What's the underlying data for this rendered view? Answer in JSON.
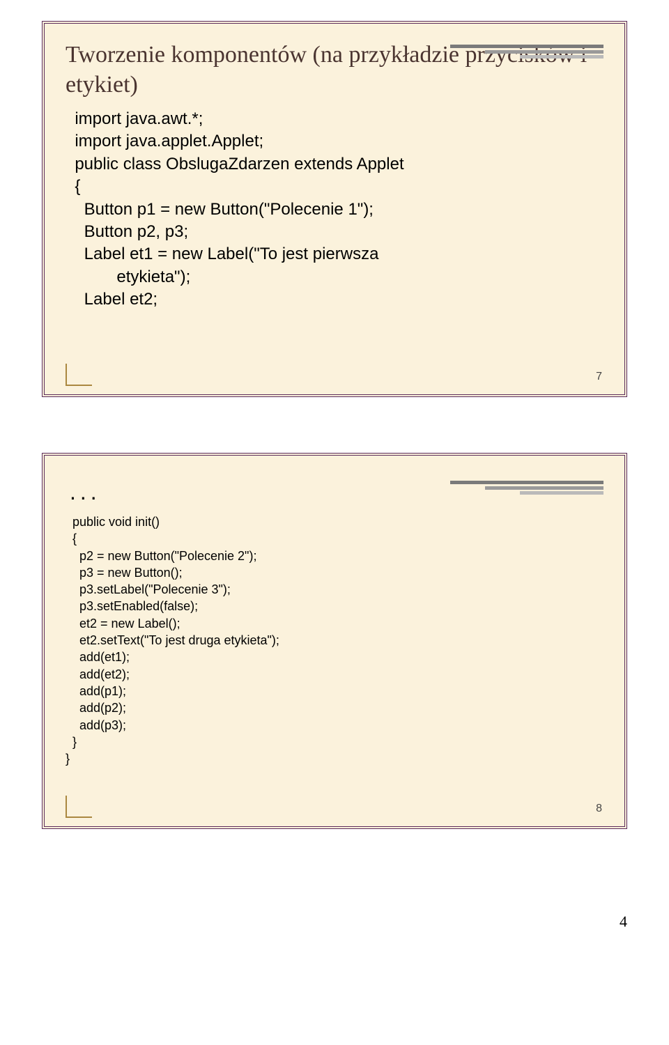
{
  "slide1": {
    "title": "Tworzenie komponentów (na przykładzie przycisków i etykiet)",
    "code": "  import java.awt.*;\n  import java.applet.Applet;\n  public class ObslugaZdarzen extends Applet\n  {\n    Button p1 = new Button(\"Polecenie 1\");\n    Button p2, p3;\n    Label et1 = new Label(\"To jest pierwsza\n           etykieta\");\n    Label et2;",
    "num": "7"
  },
  "slide2": {
    "ellipsis": "...",
    "code": "  public void init()\n  {\n    p2 = new Button(\"Polecenie 2\");\n    p3 = new Button();\n    p3.setLabel(\"Polecenie 3\");\n    p3.setEnabled(false);\n    et2 = new Label();\n    et2.setText(\"To jest druga etykieta\");\n    add(et1);\n    add(et2);\n    add(p1);\n    add(p2);\n    add(p3);\n  }\n}",
    "num": "8"
  },
  "page_num": "4"
}
